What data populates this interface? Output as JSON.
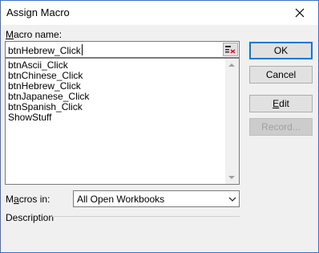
{
  "window": {
    "title": "Assign Macro"
  },
  "macro_name": {
    "label_accel": "M",
    "label_rest": "acro name:",
    "value": "btnHebrew_Click"
  },
  "macros_list": {
    "items": [
      "btnAscii_Click",
      "btnChinese_Click",
      "btnHebrew_Click",
      "btnJapanese_Click",
      "btnSpanish_Click",
      "ShowStuff"
    ]
  },
  "buttons": {
    "ok": "OK",
    "cancel": "Cancel",
    "edit_accel": "E",
    "edit_rest": "dit",
    "record": "Record..."
  },
  "macros_in": {
    "label_first": "M",
    "label_accel": "a",
    "label_rest": "cros in:",
    "selected": "All Open Workbooks"
  },
  "description": {
    "label": "Description"
  },
  "colors": {
    "accent": "#0078d7",
    "disabled_text": "#a0a0a0"
  }
}
